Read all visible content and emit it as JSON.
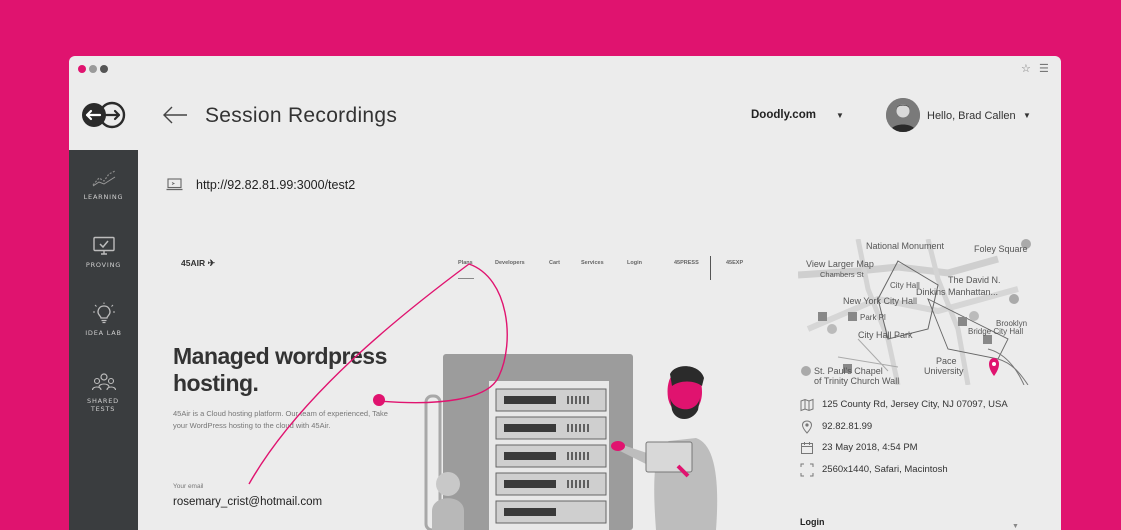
{
  "window": {
    "star_icon": "star-icon",
    "menu_icon": "hamburger-icon"
  },
  "header": {
    "title": "Session Recordings",
    "site": "Doodly.com",
    "greeting": "Hello, Brad Callen"
  },
  "sidebar": {
    "items": [
      {
        "label": "LEARNING",
        "icon": "chart-icon"
      },
      {
        "label": "PROVING",
        "icon": "monitor-check-icon"
      },
      {
        "label": "IDEA LAB",
        "icon": "lightbulb-icon"
      },
      {
        "label": "SHARED TESTS",
        "icon": "users-icon"
      }
    ]
  },
  "session": {
    "url": "http://92.82.81.99:3000/test2"
  },
  "recording": {
    "logo": "45AIR",
    "nav": [
      "Plans",
      "Developers",
      "Cart",
      "Services",
      "Login",
      "45PRESS",
      "45EXP"
    ],
    "hero_title": "Managed wordpress hosting.",
    "hero_desc": "45Air is a Cloud hosting platform. Our team of experienced, Take your WordPress hosting to the cloud with 45Air.",
    "email_label": "Your email",
    "email_value": "rosemary_crist@hotmail.com"
  },
  "map": {
    "labels": [
      "National Monument",
      "Foley Square",
      "View Larger Map",
      "Chambers St",
      "The David N.",
      "Dinkins Manhattan...",
      "City Hall",
      "New York City Hall",
      "Park Pl",
      "Brooklyn",
      "City Hall Park",
      "Bridge City Hall",
      "Pace",
      "St. Paul's Chapel",
      "University",
      "of Trinity Church Wall"
    ]
  },
  "details": {
    "address": "125 County Rd, Jersey City, NJ 07097, USA",
    "ip": "92.82.81.99",
    "datetime": "23 May 2018, 4:54 PM",
    "device": "2560x1440, Safari, Macintosh",
    "login": "Login"
  },
  "colors": {
    "accent": "#e0136f",
    "sidebar": "#3a3d3f",
    "surface": "#ececec"
  }
}
